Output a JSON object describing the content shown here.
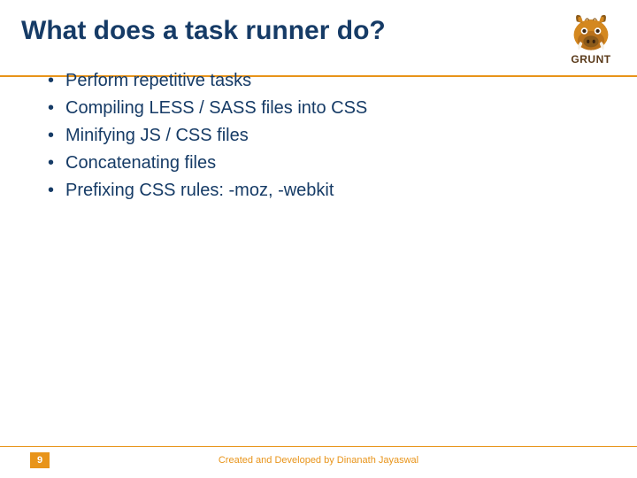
{
  "title": "What does a task runner do?",
  "logo": {
    "name": "GRUNT"
  },
  "bullets": [
    "Perform repetitive tasks",
    "Compiling LESS / SASS files into CSS",
    "Minifying JS / CSS files",
    "Concatenating files",
    "Prefixing CSS rules: -moz, -webkit"
  ],
  "footer": {
    "page": "9",
    "credit": "Created and Developed by Dinanath Jayaswal"
  }
}
